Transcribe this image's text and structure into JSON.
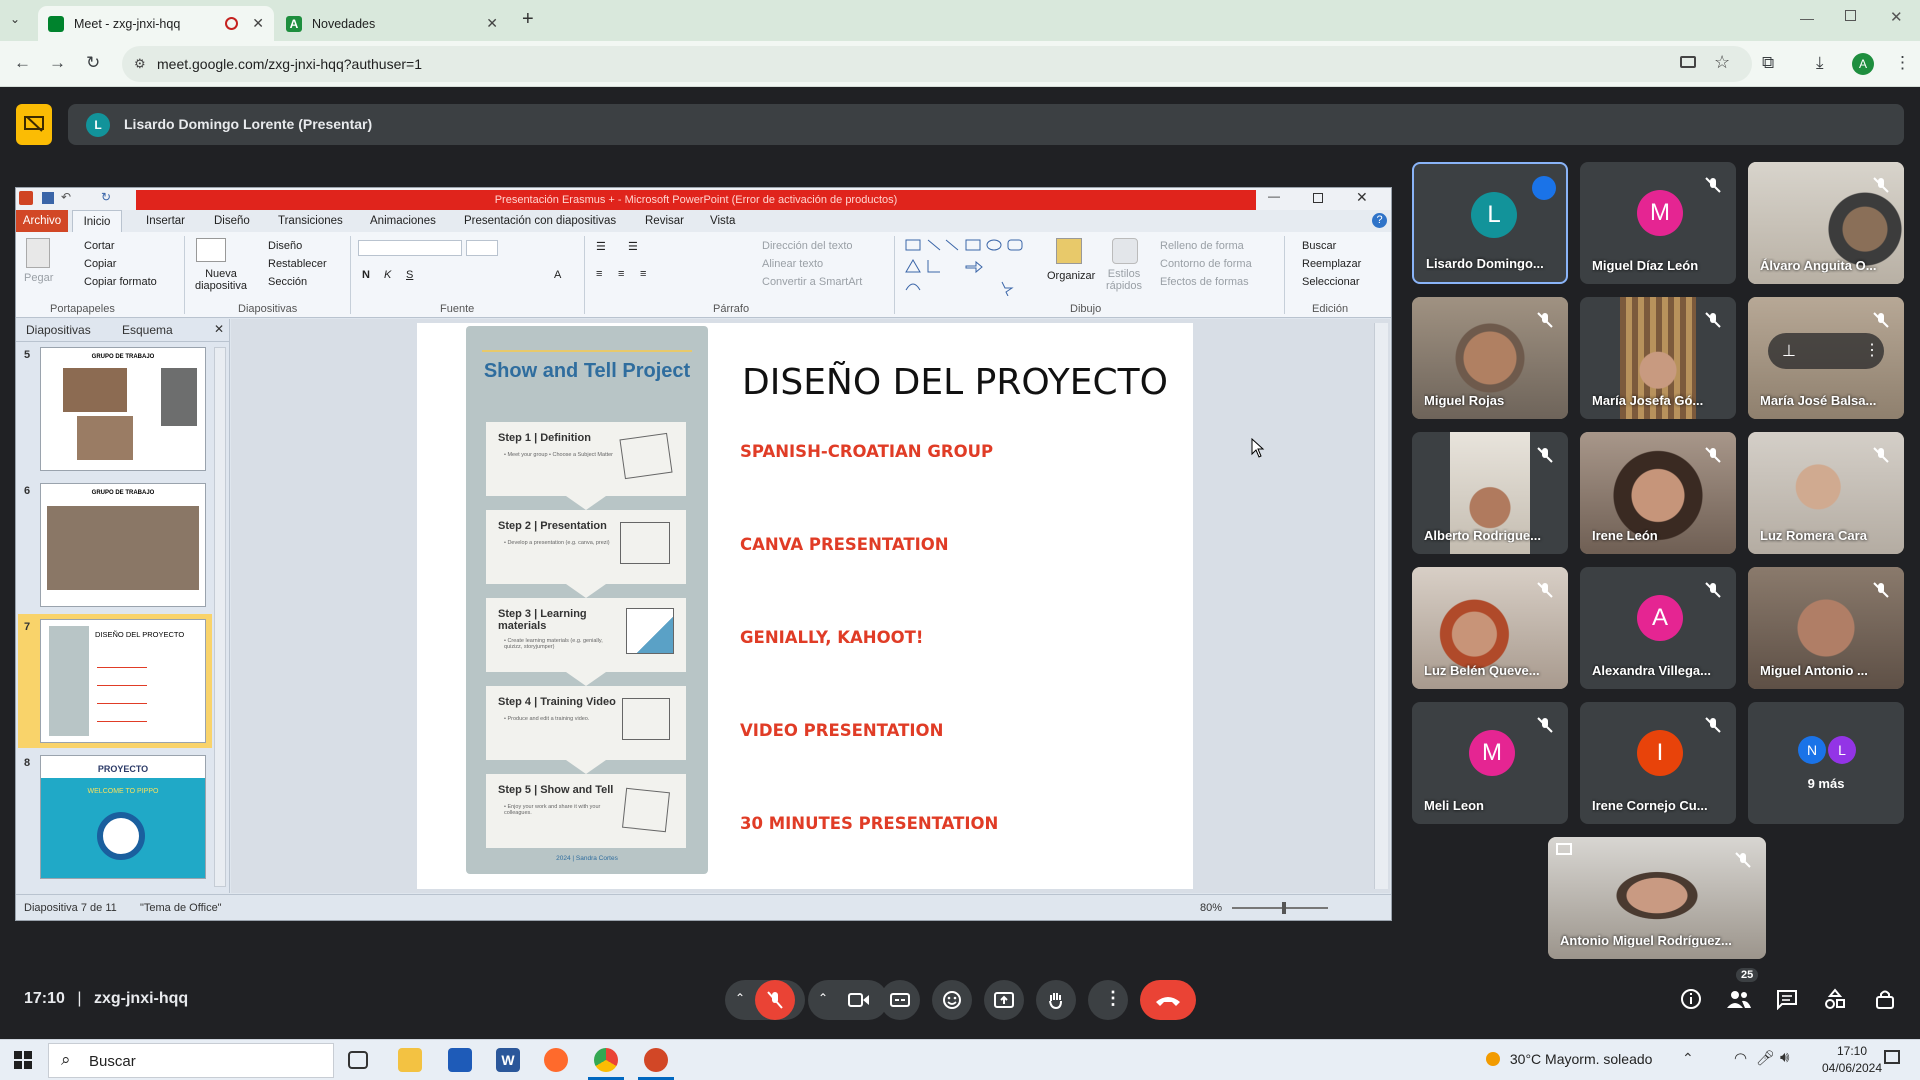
{
  "browser": {
    "tabs": [
      {
        "title": "Meet - zxg-jnxi-hqq"
      },
      {
        "title": "Novedades"
      }
    ],
    "url": "meet.google.com/zxg-jnxi-hqq?authuser=1",
    "profile_letter": "A"
  },
  "meet": {
    "presenter_banner": "Lisardo Domingo Lorente (Presentar)",
    "presenter_initial": "L",
    "time": "17:10",
    "separator": "|",
    "code": "zxg-jnxi-hqq",
    "participants_count": "25",
    "participants": [
      {
        "name": "Lisardo Domingo...",
        "initial": "L",
        "color": "#12939a"
      },
      {
        "name": "Miguel Díaz León",
        "initial": "M",
        "color": "#e52592"
      },
      {
        "name": "Álvaro Anguita O..."
      },
      {
        "name": "Miguel Rojas"
      },
      {
        "name": "María Josefa Gó..."
      },
      {
        "name": "María José Balsa..."
      },
      {
        "name": "Alberto Rodrigue..."
      },
      {
        "name": "Irene León"
      },
      {
        "name": "Luz Romera Cara"
      },
      {
        "name": "Luz Belén Queve..."
      },
      {
        "name": "Alexandra Villega...",
        "initial": "A",
        "color": "#e52592"
      },
      {
        "name": "Miguel Antonio ..."
      },
      {
        "name": "Meli Leon",
        "initial": "M",
        "color": "#e52592"
      },
      {
        "name": "Irene Cornejo Cu...",
        "initial": "I",
        "color": "#e8430a"
      },
      {
        "name": "9 más",
        "initials": [
          "N",
          "L"
        ]
      },
      {
        "name": "Antonio Miguel Rodríguez..."
      }
    ]
  },
  "ppt": {
    "title": "Presentación Erasmus + - Microsoft PowerPoint (Error de activación de productos)",
    "tabs": [
      "Archivo",
      "Inicio",
      "Insertar",
      "Diseño",
      "Transiciones",
      "Animaciones",
      "Presentación con diapositivas",
      "Revisar",
      "Vista"
    ],
    "ribbon": {
      "pegar": "Pegar",
      "cortar": "Cortar",
      "copiar": "Copiar",
      "copiar_formato": "Copiar formato",
      "portapapeles": "Portapapeles",
      "nueva": "Nueva diapositiva",
      "diseno": "Diseño",
      "restablecer": "Restablecer",
      "seccion": "Sección",
      "diapositivas": "Diapositivas",
      "fuente": "Fuente",
      "direccion": "Dirección del texto",
      "alinear": "Alinear texto",
      "smartart": "Convertir a SmartArt",
      "parrafo": "Párrafo",
      "organizar": "Organizar",
      "estilos": "Estilos rápidos",
      "relleno": "Relleno de forma",
      "contorno": "Contorno de forma",
      "efectos": "Efectos de formas",
      "dibujo": "Dibujo",
      "buscar": "Buscar",
      "reemplazar": "Reemplazar",
      "seleccionar": "Seleccionar",
      "edicion": "Edición"
    },
    "pane_tabs": [
      "Diapositivas",
      "Esquema"
    ],
    "thumbs": [
      {
        "num": "5",
        "title": "GRUPO DE TRABAJO"
      },
      {
        "num": "6",
        "title": "GRUPO DE TRABAJO"
      },
      {
        "num": "7",
        "title": "DISEÑO DEL PROYECTO"
      },
      {
        "num": "8",
        "title": "PROYECTO",
        "subtitle": "WELCOME TO PIPPO"
      }
    ],
    "status": {
      "slide": "Diapositiva 7 de 11",
      "theme": "\"Tema de Office\"",
      "zoom": "80%"
    },
    "slide": {
      "title": "DISEÑO DEL PROYECTO",
      "bullets": [
        "SPANISH-CROATIAN GROUP",
        "CANVA PRESENTATION",
        "GENIALLY, KAHOOT!",
        "VIDEO PRESENTATION",
        "30 MINUTES PRESENTATION"
      ],
      "infographic": {
        "title": "Show and Tell Project",
        "steps": [
          {
            "title": "Step 1 | Definition",
            "desc": "• Meet your group • Choose a Subject Matter"
          },
          {
            "title": "Step 2 | Presentation",
            "desc": "• Develop a presentation (e.g. canva, prezi)"
          },
          {
            "title": "Step 3 | Learning materials",
            "desc": "• Create learning materials (e.g. genially, quizizz, storyjumper)"
          },
          {
            "title": "Step 4 | Training Video",
            "desc": "• Produce and edit a training video."
          },
          {
            "title": "Step 5 | Show and Tell",
            "desc": "• Enjoy your work and share it with your colleagues."
          }
        ],
        "footer": "2024 | Sandra Cortes"
      }
    }
  },
  "taskbar": {
    "search": "Buscar",
    "weather": "30°C  Mayorm. soleado",
    "time": "17:10",
    "date": "04/06/2024"
  }
}
